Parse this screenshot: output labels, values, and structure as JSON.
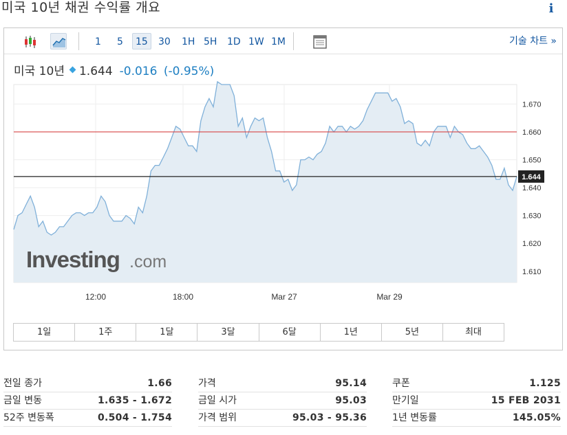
{
  "header": {
    "title": "미국 10년 채권 수익률 개요"
  },
  "toolbar": {
    "intervals": [
      "1",
      "5",
      "15",
      "30",
      "1H",
      "5H",
      "1D",
      "1W",
      "1M"
    ],
    "active_interval": "15",
    "tech_chart_link": "기술 차트 »"
  },
  "quote": {
    "name": "미국 10년",
    "last": "1.644",
    "change": "-0.016",
    "change_pct": "(-0.95%)"
  },
  "chart_data": {
    "type": "area",
    "watermark": "Investing",
    "watermark_suffix": ".com",
    "ylim": [
      1.606,
      1.677
    ],
    "yticks": [
      "1.670",
      "1.660",
      "1.650",
      "1.640",
      "1.630",
      "1.620",
      "1.610"
    ],
    "xticks": [
      "12:00",
      "18:00",
      "Mar 27",
      "Mar 29"
    ],
    "current_value_label": "1.644",
    "current_value": 1.644,
    "reference_line": 1.66,
    "colors": {
      "line": "#7fb0d9",
      "fill": "#e4edf4",
      "ref_line": "#d64545",
      "current_line": "#222222"
    },
    "y": [
      1.625,
      1.63,
      1.631,
      1.634,
      1.637,
      1.633,
      1.626,
      1.628,
      1.624,
      1.623,
      1.624,
      1.626,
      1.626,
      1.628,
      1.63,
      1.631,
      1.631,
      1.63,
      1.631,
      1.631,
      1.633,
      1.637,
      1.635,
      1.63,
      1.628,
      1.628,
      1.628,
      1.63,
      1.629,
      1.627,
      1.633,
      1.631,
      1.637,
      1.646,
      1.648,
      1.648,
      1.651,
      1.654,
      1.658,
      1.662,
      1.661,
      1.658,
      1.655,
      1.655,
      1.653,
      1.664,
      1.669,
      1.672,
      1.669,
      1.678,
      1.677,
      1.677,
      1.677,
      1.673,
      1.662,
      1.665,
      1.658,
      1.662,
      1.665,
      1.664,
      1.665,
      1.658,
      1.653,
      1.646,
      1.646,
      1.642,
      1.643,
      1.639,
      1.641,
      1.65,
      1.65,
      1.651,
      1.65,
      1.652,
      1.653,
      1.656,
      1.662,
      1.66,
      1.662,
      1.662,
      1.66,
      1.662,
      1.661,
      1.662,
      1.664,
      1.668,
      1.671,
      1.674,
      1.674,
      1.674,
      1.674,
      1.671,
      1.672,
      1.669,
      1.663,
      1.664,
      1.663,
      1.656,
      1.655,
      1.657,
      1.655,
      1.66,
      1.662,
      1.662,
      1.662,
      1.658,
      1.662,
      1.66,
      1.659,
      1.656,
      1.654,
      1.654,
      1.655,
      1.653,
      1.651,
      1.648,
      1.643,
      1.643,
      1.647,
      1.641,
      1.639,
      1.644
    ]
  },
  "range_buttons": [
    "1일",
    "1주",
    "1달",
    "3달",
    "6달",
    "1년",
    "5년",
    "최대"
  ],
  "stats": [
    [
      {
        "label": "전일 종가",
        "value": "1.66"
      },
      {
        "label": "금일 변동",
        "value": "1.635 - 1.672"
      },
      {
        "label": "52주 변동폭",
        "value": "0.504 - 1.754"
      }
    ],
    [
      {
        "label": "가격",
        "value": "95.14"
      },
      {
        "label": "금일 시가",
        "value": "95.03"
      },
      {
        "label": "가격 범위",
        "value": "95.03 - 95.36"
      }
    ],
    [
      {
        "label": "쿠폰",
        "value": "1.125"
      },
      {
        "label": "만기일",
        "value": "15 FEB 2031"
      },
      {
        "label": "1년 변동률",
        "value": "145.05%"
      }
    ]
  ]
}
